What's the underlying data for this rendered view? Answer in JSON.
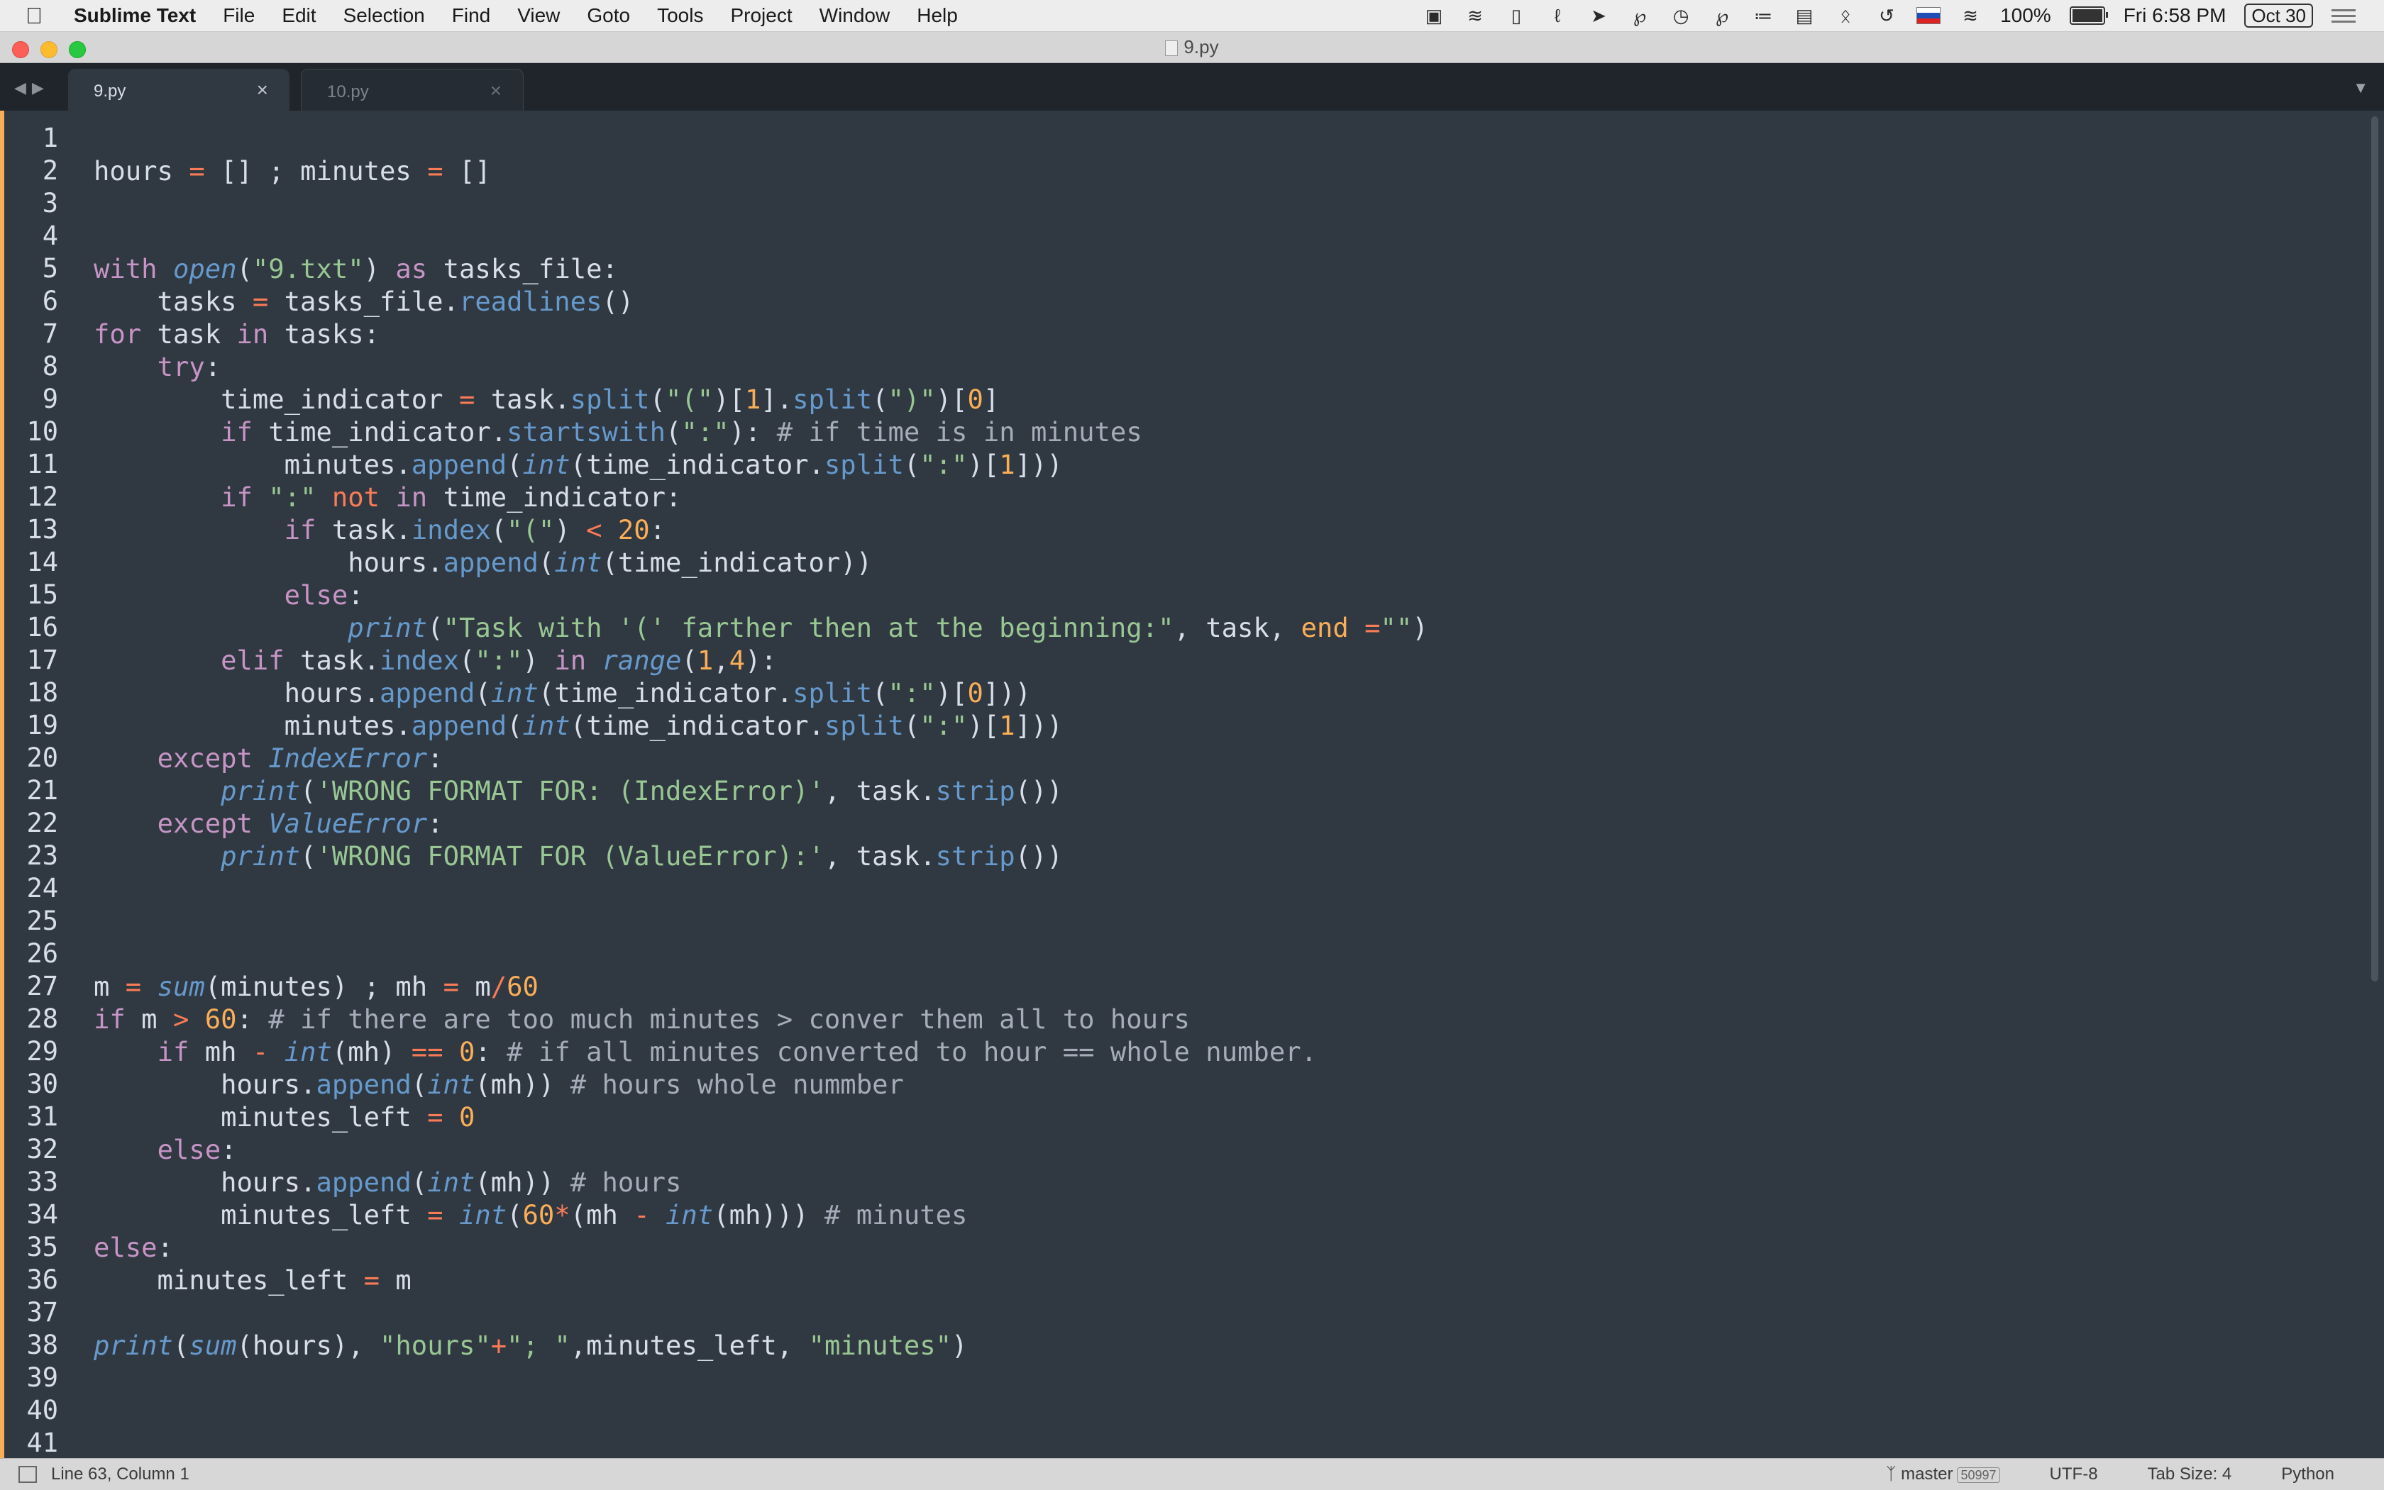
{
  "menubar": {
    "app_name": "Sublime Text",
    "items": [
      "File",
      "Edit",
      "Selection",
      "Find",
      "View",
      "Goto",
      "Tools",
      "Project",
      "Window",
      "Help"
    ],
    "battery": "100%",
    "battery_level": 1.0,
    "clock": "Fri 6:58 PM",
    "date": "Oct 30",
    "status_icons": [
      "screen-icon",
      "waveform-icon",
      "mouse-icon",
      "paperclip-icon",
      "send-icon",
      "pin-icon",
      "clock-icon",
      "pin-icon-2",
      "signal-icon",
      "document-icon",
      "bluetooth-icon",
      "time-machine-icon",
      "flag-icon",
      "wifi-icon",
      "battery-icon",
      "menu-list-icon"
    ]
  },
  "window": {
    "title": "9.py"
  },
  "tabs": [
    {
      "label": "9.py",
      "active": true
    },
    {
      "label": "10.py",
      "active": false
    }
  ],
  "editor": {
    "line_numbers": [
      "1",
      "2",
      "3",
      "4",
      "5",
      "6",
      "7",
      "8",
      "9",
      "10",
      "11",
      "12",
      "13",
      "14",
      "15",
      "16",
      "17",
      "18",
      "19",
      "20",
      "21",
      "22",
      "23",
      "24",
      "25",
      "26",
      "27",
      "28",
      "29",
      "30",
      "31",
      "32",
      "33",
      "34",
      "35",
      "36",
      "37",
      "38",
      "39",
      "40",
      "41"
    ],
    "lines": [
      [],
      [
        [
          "plain",
          "hours "
        ],
        [
          "op",
          "="
        ],
        [
          "plain",
          " [] ; minutes "
        ],
        [
          "op",
          "="
        ],
        [
          "plain",
          " []"
        ]
      ],
      [],
      [],
      [
        [
          "kw",
          "with "
        ],
        [
          "fn",
          "open"
        ],
        [
          "punc",
          "("
        ],
        [
          "str",
          "\"9.txt\""
        ],
        [
          "punc",
          ")"
        ],
        [
          "kw",
          " as"
        ],
        [
          "plain",
          " tasks_file:"
        ]
      ],
      [
        [
          "plain",
          "    tasks "
        ],
        [
          "op",
          "="
        ],
        [
          "plain",
          " tasks_file."
        ],
        [
          "meth",
          "readlines"
        ],
        [
          "punc",
          "()"
        ]
      ],
      [
        [
          "kw",
          "for"
        ],
        [
          "plain",
          " task "
        ],
        [
          "kw",
          "in"
        ],
        [
          "plain",
          " tasks:"
        ]
      ],
      [
        [
          "plain",
          "    "
        ],
        [
          "kw",
          "try"
        ],
        [
          "plain",
          ":"
        ]
      ],
      [
        [
          "plain",
          "        time_indicator "
        ],
        [
          "op",
          "="
        ],
        [
          "plain",
          " task."
        ],
        [
          "meth",
          "split"
        ],
        [
          "punc",
          "("
        ],
        [
          "str",
          "\"(\""
        ],
        [
          "punc",
          ")["
        ],
        [
          "num",
          "1"
        ],
        [
          "punc",
          "]."
        ],
        [
          "meth",
          "split"
        ],
        [
          "punc",
          "("
        ],
        [
          "str",
          "\")\""
        ],
        [
          "punc",
          ")["
        ],
        [
          "num",
          "0"
        ],
        [
          "punc",
          "]"
        ]
      ],
      [
        [
          "plain",
          "        "
        ],
        [
          "kw",
          "if"
        ],
        [
          "plain",
          " time_indicator."
        ],
        [
          "meth",
          "startswith"
        ],
        [
          "punc",
          "("
        ],
        [
          "str",
          "\":\""
        ],
        [
          "punc",
          "):"
        ],
        [
          "cmt",
          " # if time is in minutes"
        ]
      ],
      [
        [
          "plain",
          "            minutes."
        ],
        [
          "meth",
          "append"
        ],
        [
          "punc",
          "("
        ],
        [
          "fn",
          "int"
        ],
        [
          "punc",
          "("
        ],
        [
          "plain",
          "time_indicator."
        ],
        [
          "meth",
          "split"
        ],
        [
          "punc",
          "("
        ],
        [
          "str",
          "\":\""
        ],
        [
          "punc",
          ")["
        ],
        [
          "num",
          "1"
        ],
        [
          "punc",
          "]))"
        ]
      ],
      [
        [
          "plain",
          "        "
        ],
        [
          "kw",
          "if"
        ],
        [
          "str",
          " \":\""
        ],
        [
          "op",
          " not"
        ],
        [
          "kw",
          " in"
        ],
        [
          "plain",
          " time_indicator:"
        ]
      ],
      [
        [
          "plain",
          "            "
        ],
        [
          "kw",
          "if"
        ],
        [
          "plain",
          " task."
        ],
        [
          "meth",
          "index"
        ],
        [
          "punc",
          "("
        ],
        [
          "str",
          "\"(\""
        ],
        [
          "punc",
          ")"
        ],
        [
          "op",
          " <"
        ],
        [
          "num",
          " 20"
        ],
        [
          "plain",
          ":"
        ]
      ],
      [
        [
          "plain",
          "                hours."
        ],
        [
          "meth",
          "append"
        ],
        [
          "punc",
          "("
        ],
        [
          "fn",
          "int"
        ],
        [
          "punc",
          "("
        ],
        [
          "plain",
          "time_indicator"
        ],
        [
          "punc",
          "))"
        ]
      ],
      [
        [
          "plain",
          "            "
        ],
        [
          "kw",
          "else"
        ],
        [
          "plain",
          ":"
        ]
      ],
      [
        [
          "plain",
          "                "
        ],
        [
          "fn",
          "print"
        ],
        [
          "punc",
          "("
        ],
        [
          "str",
          "\"Task with '(' farther then at the beginning:\""
        ],
        [
          "punc",
          ","
        ],
        [
          "plain",
          " task,"
        ],
        [
          "param",
          " end"
        ],
        [
          "op",
          " ="
        ],
        [
          "str",
          "\"\""
        ],
        [
          "punc",
          ")"
        ]
      ],
      [
        [
          "plain",
          "        "
        ],
        [
          "kw",
          "elif"
        ],
        [
          "plain",
          " task."
        ],
        [
          "meth",
          "index"
        ],
        [
          "punc",
          "("
        ],
        [
          "str",
          "\":\""
        ],
        [
          "punc",
          ")"
        ],
        [
          "kw",
          " in"
        ],
        [
          "plain",
          " "
        ],
        [
          "fn",
          "range"
        ],
        [
          "punc",
          "("
        ],
        [
          "num",
          "1"
        ],
        [
          "punc",
          ","
        ],
        [
          "num",
          "4"
        ],
        [
          "punc",
          "):"
        ]
      ],
      [
        [
          "plain",
          "            hours."
        ],
        [
          "meth",
          "append"
        ],
        [
          "punc",
          "("
        ],
        [
          "fn",
          "int"
        ],
        [
          "punc",
          "("
        ],
        [
          "plain",
          "time_indicator."
        ],
        [
          "meth",
          "split"
        ],
        [
          "punc",
          "("
        ],
        [
          "str",
          "\":\""
        ],
        [
          "punc",
          ")["
        ],
        [
          "num",
          "0"
        ],
        [
          "punc",
          "]))"
        ]
      ],
      [
        [
          "plain",
          "            minutes."
        ],
        [
          "meth",
          "append"
        ],
        [
          "punc",
          "("
        ],
        [
          "fn",
          "int"
        ],
        [
          "punc",
          "("
        ],
        [
          "plain",
          "time_indicator."
        ],
        [
          "meth",
          "split"
        ],
        [
          "punc",
          "("
        ],
        [
          "str",
          "\":\""
        ],
        [
          "punc",
          ")["
        ],
        [
          "num",
          "1"
        ],
        [
          "punc",
          "]))"
        ]
      ],
      [
        [
          "plain",
          "    "
        ],
        [
          "kw",
          "except"
        ],
        [
          "plain",
          " "
        ],
        [
          "fn",
          "IndexError"
        ],
        [
          "plain",
          ":"
        ]
      ],
      [
        [
          "plain",
          "        "
        ],
        [
          "fn",
          "print"
        ],
        [
          "punc",
          "("
        ],
        [
          "str",
          "'WRONG FORMAT FOR: (IndexError)'"
        ],
        [
          "punc",
          ","
        ],
        [
          "plain",
          " task."
        ],
        [
          "meth",
          "strip"
        ],
        [
          "punc",
          "())"
        ]
      ],
      [
        [
          "plain",
          "    "
        ],
        [
          "kw",
          "except"
        ],
        [
          "plain",
          " "
        ],
        [
          "fn",
          "ValueError"
        ],
        [
          "plain",
          ":"
        ]
      ],
      [
        [
          "plain",
          "        "
        ],
        [
          "fn",
          "print"
        ],
        [
          "punc",
          "("
        ],
        [
          "str",
          "'WRONG FORMAT FOR (ValueError):'"
        ],
        [
          "punc",
          ","
        ],
        [
          "plain",
          " task."
        ],
        [
          "meth",
          "strip"
        ],
        [
          "punc",
          "())"
        ]
      ],
      [],
      [],
      [],
      [
        [
          "plain",
          "m "
        ],
        [
          "op",
          "="
        ],
        [
          "plain",
          " "
        ],
        [
          "fn",
          "sum"
        ],
        [
          "punc",
          "("
        ],
        [
          "plain",
          "minutes"
        ],
        [
          "punc",
          ")"
        ],
        [
          "plain",
          " ; mh "
        ],
        [
          "op",
          "="
        ],
        [
          "plain",
          " m"
        ],
        [
          "op",
          "/"
        ],
        [
          "num",
          "60"
        ]
      ],
      [
        [
          "kw",
          "if"
        ],
        [
          "plain",
          " m "
        ],
        [
          "op",
          ">"
        ],
        [
          "num",
          " 60"
        ],
        [
          "plain",
          ":"
        ],
        [
          "cmt",
          " # if there are too much minutes > conver them all to hours"
        ]
      ],
      [
        [
          "plain",
          "    "
        ],
        [
          "kw",
          "if"
        ],
        [
          "plain",
          " mh "
        ],
        [
          "op",
          "-"
        ],
        [
          "plain",
          " "
        ],
        [
          "fn",
          "int"
        ],
        [
          "punc",
          "("
        ],
        [
          "plain",
          "mh"
        ],
        [
          "punc",
          ")"
        ],
        [
          "op",
          " =="
        ],
        [
          "num",
          " 0"
        ],
        [
          "plain",
          ":"
        ],
        [
          "cmt",
          " # if all minutes converted to hour == whole number."
        ]
      ],
      [
        [
          "plain",
          "        hours."
        ],
        [
          "meth",
          "append"
        ],
        [
          "punc",
          "("
        ],
        [
          "fn",
          "int"
        ],
        [
          "punc",
          "("
        ],
        [
          "plain",
          "mh"
        ],
        [
          "punc",
          "))"
        ],
        [
          "cmt",
          " # hours whole nummber"
        ]
      ],
      [
        [
          "plain",
          "        minutes_left "
        ],
        [
          "op",
          "="
        ],
        [
          "num",
          " 0"
        ]
      ],
      [
        [
          "plain",
          "    "
        ],
        [
          "kw",
          "else"
        ],
        [
          "plain",
          ":"
        ]
      ],
      [
        [
          "plain",
          "        hours."
        ],
        [
          "meth",
          "append"
        ],
        [
          "punc",
          "("
        ],
        [
          "fn",
          "int"
        ],
        [
          "punc",
          "("
        ],
        [
          "plain",
          "mh"
        ],
        [
          "punc",
          "))"
        ],
        [
          "cmt",
          " # hours"
        ]
      ],
      [
        [
          "plain",
          "        minutes_left "
        ],
        [
          "op",
          "="
        ],
        [
          "plain",
          " "
        ],
        [
          "fn",
          "int"
        ],
        [
          "punc",
          "("
        ],
        [
          "num",
          "60"
        ],
        [
          "op",
          "*"
        ],
        [
          "punc",
          "("
        ],
        [
          "plain",
          "mh "
        ],
        [
          "op",
          "-"
        ],
        [
          "plain",
          " "
        ],
        [
          "fn",
          "int"
        ],
        [
          "punc",
          "("
        ],
        [
          "plain",
          "mh"
        ],
        [
          "punc",
          ")))"
        ],
        [
          "cmt",
          " # minutes"
        ]
      ],
      [
        [
          "kw",
          "else"
        ],
        [
          "plain",
          ":"
        ]
      ],
      [
        [
          "plain",
          "    minutes_left "
        ],
        [
          "op",
          "="
        ],
        [
          "plain",
          " m"
        ]
      ],
      [],
      [
        [
          "fn",
          "print"
        ],
        [
          "punc",
          "("
        ],
        [
          "fn",
          "sum"
        ],
        [
          "punc",
          "("
        ],
        [
          "plain",
          "hours"
        ],
        [
          "punc",
          "),"
        ],
        [
          "plain",
          " "
        ],
        [
          "str",
          "\"hours\""
        ],
        [
          "op",
          "+"
        ],
        [
          "str",
          "\"; \""
        ],
        [
          "punc",
          ","
        ],
        [
          "plain",
          "minutes_left,"
        ],
        [
          "plain",
          " "
        ],
        [
          "str",
          "\"minutes\""
        ],
        [
          "punc",
          ")"
        ]
      ],
      [],
      [],
      []
    ]
  },
  "statusbar": {
    "position": "Line 63, Column 1",
    "branch": "master",
    "branch_count": "50997",
    "encoding": "UTF-8",
    "tab_size": "Tab Size: 4",
    "syntax": "Python"
  }
}
